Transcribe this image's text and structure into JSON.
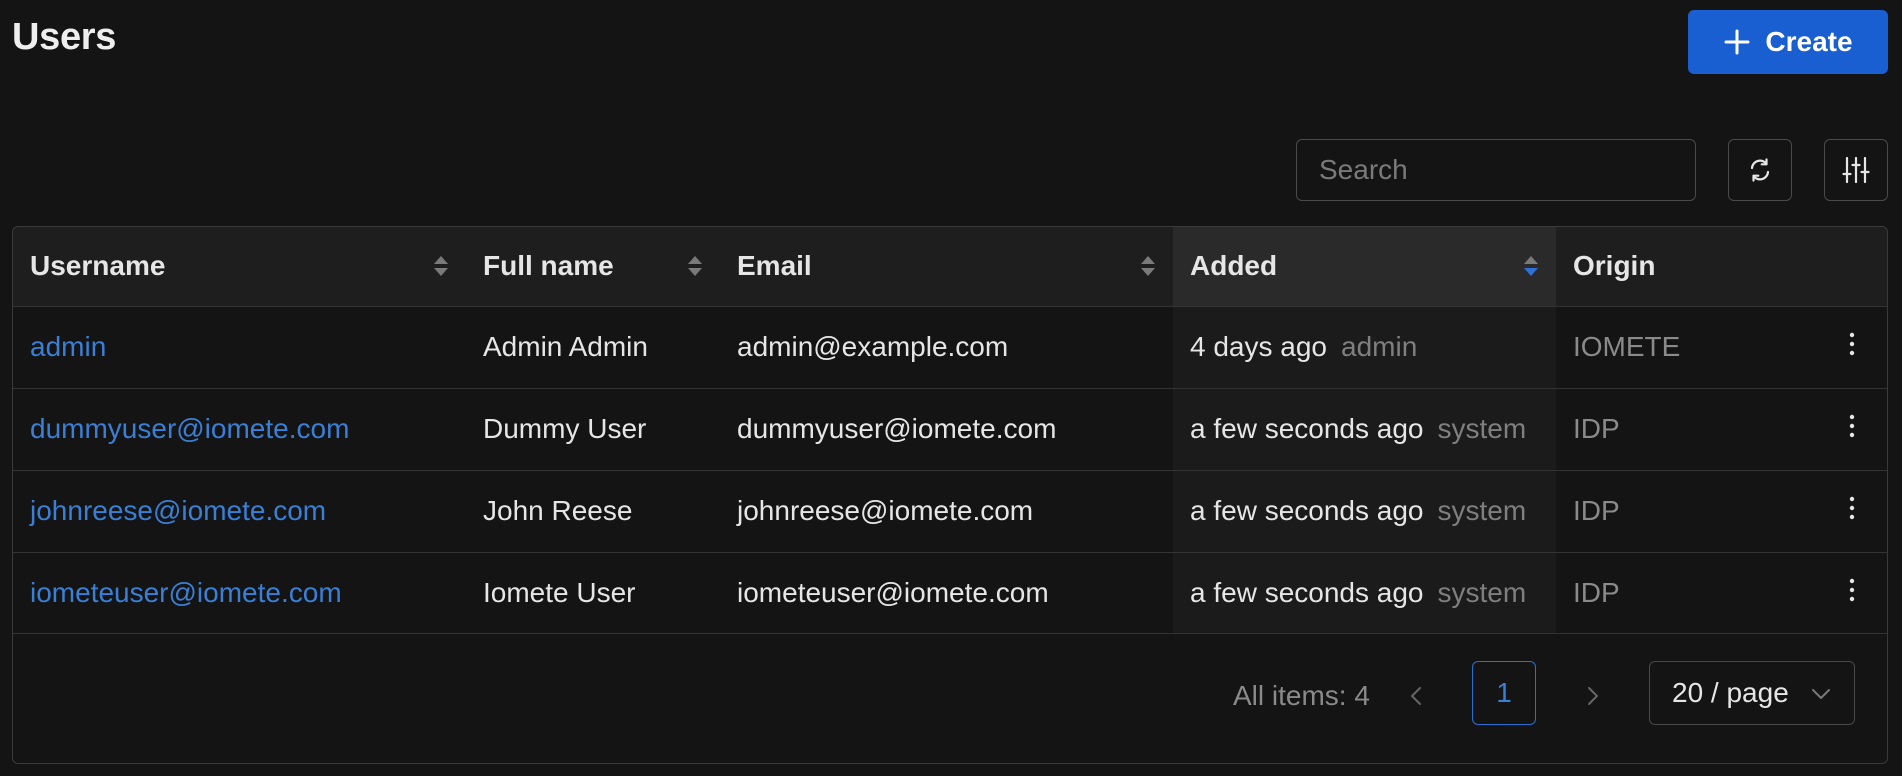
{
  "header": {
    "title": "Users",
    "create_label": "Create"
  },
  "toolbar": {
    "search_placeholder": "Search",
    "refresh_icon": "refresh-icon",
    "columns_icon": "sliders-icon"
  },
  "table": {
    "columns": [
      "Username",
      "Full name",
      "Email",
      "Added",
      "Origin"
    ],
    "sorted_column": "Added",
    "rows": [
      {
        "username": "admin",
        "full_name": "Admin Admin",
        "email": "admin@example.com",
        "added": "4 days ago",
        "added_by": "admin",
        "origin": "IOMETE"
      },
      {
        "username": "dummyuser@iomete.com",
        "full_name": "Dummy User",
        "email": "dummyuser@iomete.com",
        "added": "a few seconds ago",
        "added_by": "system",
        "origin": "IDP"
      },
      {
        "username": "johnreese@iomete.com",
        "full_name": "John Reese",
        "email": "johnreese@iomete.com",
        "added": "a few seconds ago",
        "added_by": "system",
        "origin": "IDP"
      },
      {
        "username": "iometeuser@iomete.com",
        "full_name": "Iomete User",
        "email": "iometeuser@iomete.com",
        "added": "a few seconds ago",
        "added_by": "system",
        "origin": "IDP"
      }
    ]
  },
  "pagination": {
    "total_label": "All items: 4",
    "current_page": "1",
    "page_size": "20 / page"
  },
  "colors": {
    "accent": "#1a5fd1",
    "link": "#3a7fd6",
    "background": "#141414"
  }
}
